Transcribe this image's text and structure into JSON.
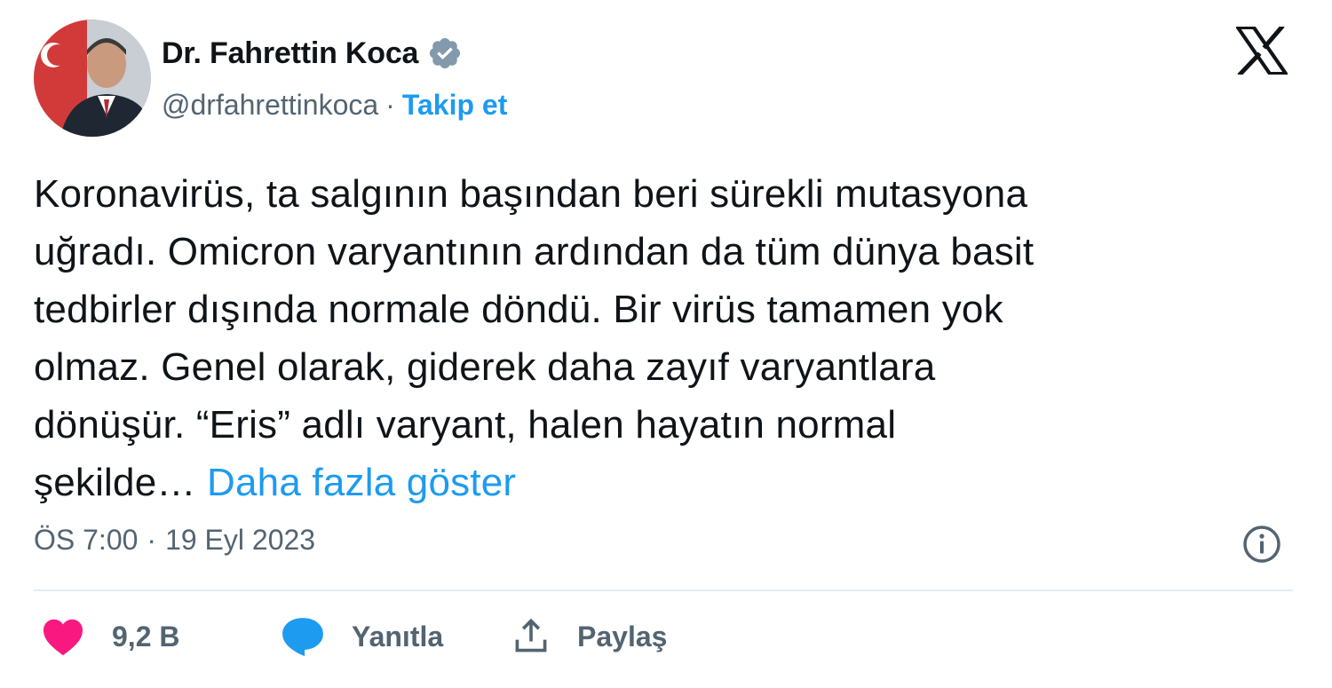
{
  "author": {
    "display_name": "Dr. Fahrettin Koca",
    "handle": "@drfahrettinkoca",
    "separator": "·",
    "follow_label": "Takip et",
    "verified_icon": "verified-badge-icon"
  },
  "tweet": {
    "lines": [
      "Koronavirüs, ta salgının başından beri sürekli mutasyona",
      "uğradı. Omicron varyantının ardından da tüm dünya basit",
      "tedbirler dışında normale döndü. Bir virüs tamamen yok",
      "olmaz. Genel olarak, giderek daha zayıf varyantlara",
      "dönüşür. “Eris” adlı varyant, halen hayatın normal",
      "şekilde…"
    ],
    "show_more": "Daha fazla göster",
    "time": "ÖS 7:00",
    "meta_separator": "·",
    "date": "19 Eyl 2023"
  },
  "actions": {
    "like_count": "9,2 B",
    "reply_label": "Yanıtla",
    "share_label": "Paylaş"
  },
  "colors": {
    "accent": "#1d9bf0",
    "like": "#f91880",
    "muted": "#536471",
    "text": "#0f1419"
  }
}
